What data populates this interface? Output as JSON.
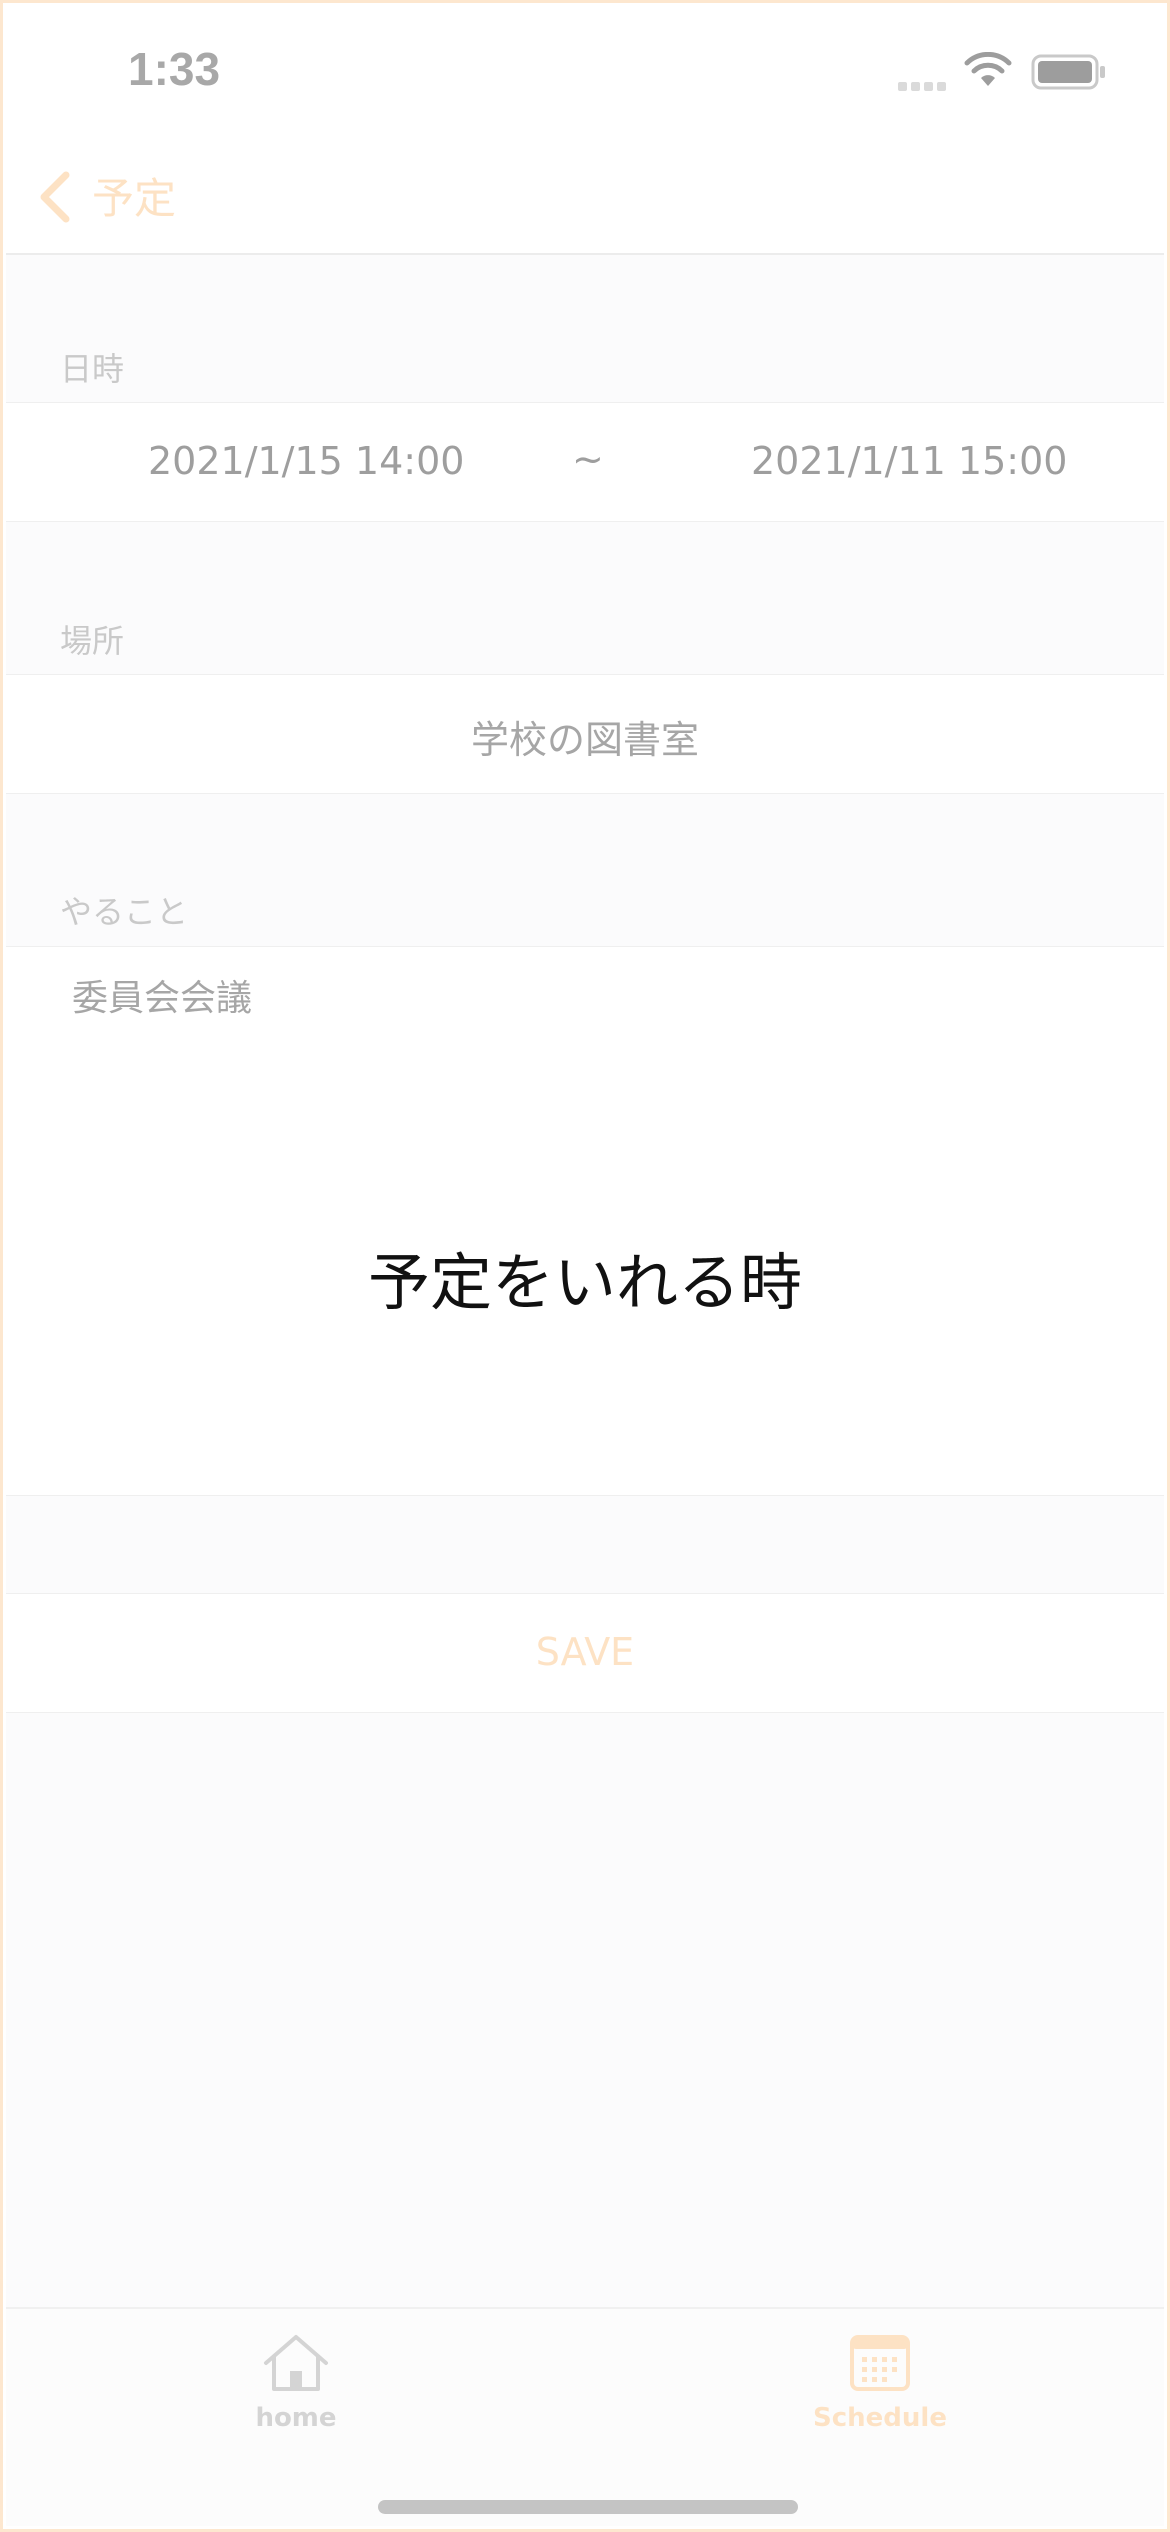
{
  "status_bar": {
    "time": "1:33"
  },
  "nav": {
    "back_label": "予定"
  },
  "datetime": {
    "header": "日時",
    "start": "2021/1/15 14:00",
    "separator": "~",
    "end": "2021/1/11 15:00"
  },
  "place": {
    "header": "場所",
    "value": "学校の図書室"
  },
  "todo": {
    "header": "やること",
    "value": "委員会会議"
  },
  "overlay_caption": "予定をいれる時",
  "save_button": {
    "label": "SAVE"
  },
  "tab_bar": {
    "items": [
      {
        "label": "home",
        "icon": "house-icon"
      },
      {
        "label": "Schedule",
        "icon": "calendar-icon"
      }
    ]
  },
  "colors": {
    "accent": "#fde2c4",
    "border": "#fde7cf"
  }
}
